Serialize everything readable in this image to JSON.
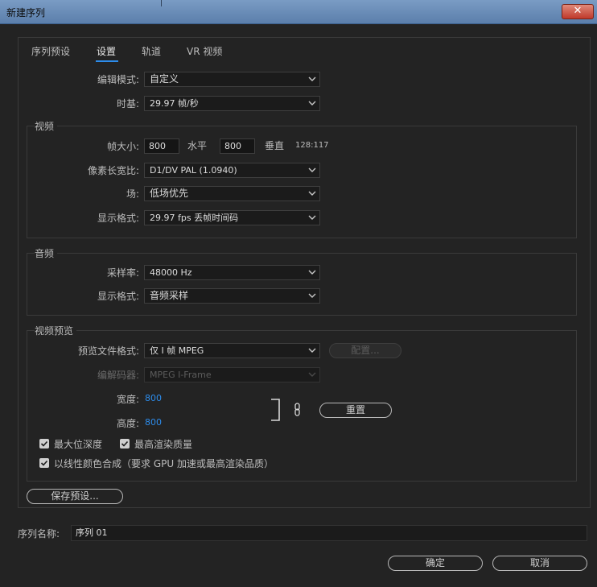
{
  "window": {
    "title": "新建序列",
    "close_glyph": "✕"
  },
  "tabs": [
    {
      "label": "序列预设"
    },
    {
      "label": "设置"
    },
    {
      "label": "轨道"
    },
    {
      "label": "VR 视频"
    }
  ],
  "settings": {
    "edit_mode": {
      "label": "编辑模式:",
      "value": "自定义"
    },
    "timebase": {
      "label": "时基:",
      "value": "29.97  帧/秒"
    }
  },
  "video": {
    "title": "视频",
    "frame_size": {
      "label": "帧大小:",
      "width": "800",
      "h_label": "水平",
      "height": "800",
      "v_label": "垂直",
      "ratio": "128:117"
    },
    "pixel_aspect": {
      "label": "像素长宽比:",
      "value": "D1/DV PAL (1.0940)"
    },
    "fields": {
      "label": "场:",
      "value": "低场优先"
    },
    "display_format": {
      "label": "显示格式:",
      "value": "29.97 fps 丢帧时间码"
    }
  },
  "audio": {
    "title": "音频",
    "sample_rate": {
      "label": "采样率:",
      "value": "48000 Hz"
    },
    "display_format": {
      "label": "显示格式:",
      "value": "音频采样"
    }
  },
  "preview": {
    "title": "视频预览",
    "file_format": {
      "label": "预览文件格式:",
      "value": "仅 I 帧 MPEG"
    },
    "config_button": "配置...",
    "codec": {
      "label": "编解码器:",
      "value": "MPEG I-Frame"
    },
    "width": {
      "label": "宽度:",
      "value": "800"
    },
    "height": {
      "label": "高度:",
      "value": "800"
    },
    "reset_button": "重置",
    "max_bit_depth": {
      "label": "最大位深度",
      "checked": true
    },
    "max_render_quality": {
      "label": "最高渲染质量",
      "checked": true
    },
    "linear_color": {
      "label": "以线性颜色合成（要求 GPU 加速或最高渲染品质）",
      "checked": true
    }
  },
  "save_preset_button": "保存预设...",
  "sequence_name": {
    "label": "序列名称:",
    "value": "序列 01"
  },
  "ok_button": "确定",
  "cancel_button": "取消",
  "colors": {
    "accent": "#2d8ceb",
    "titlebar": "#6a8dba",
    "background": "#232323",
    "close": "#c0392b"
  }
}
